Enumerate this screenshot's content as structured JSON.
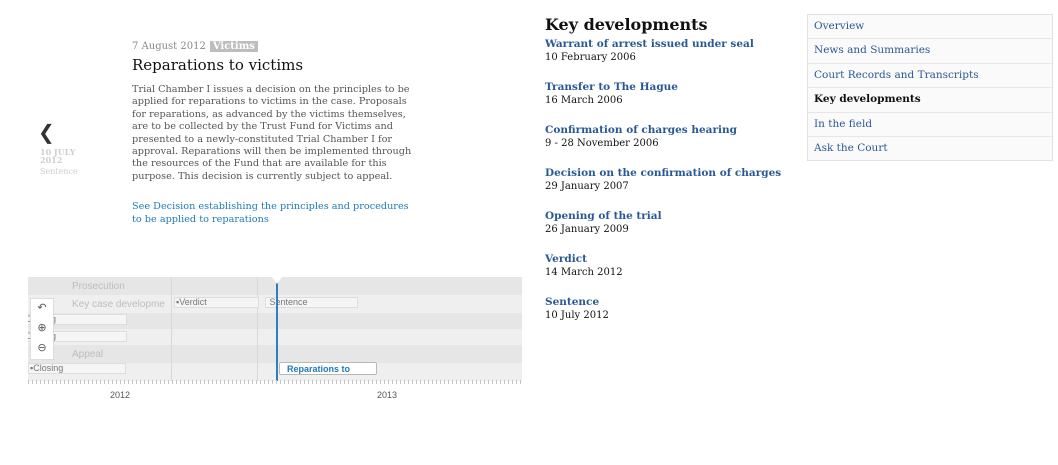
{
  "story": {
    "date": "7 August 2012",
    "tag": "Victims",
    "title": "Reparations to victims",
    "body": "Trial Chamber I issues a decision on the principles to be applied for reparations to victims in the case. Proposals for reparations, as advanced by the victims themselves, are to be collected by the Trust Fund for Victims and presented to a newly-constituted Trial Chamber I for approval. Reparations will then be implemented through the resources of the Fund that are available for this purpose. This decision is currently subject to appeal.",
    "link": "See Decision establishing the principles and procedures to be applied to reparations"
  },
  "previous": {
    "arrow": "❮",
    "date": "10 JULY 2012",
    "label": "Sentence"
  },
  "timeline": {
    "bands": [
      "Prosecution",
      "Key case developme",
      "",
      "",
      "Appeal"
    ],
    "events": {
      "verdict": "Verdict",
      "sentence": "Sentence",
      "closing1": "Closing",
      "closing2": "Closing",
      "closing3": "Closing"
    },
    "zoom": {
      "back": "↶",
      "zoom_in": "⊕",
      "zoom_out": "⊖"
    },
    "active_event": "Reparations to",
    "axis_years": [
      "2012",
      "2013"
    ]
  },
  "key_developments": {
    "heading": "Key developments",
    "items": [
      {
        "title": "Warrant of arrest issued under seal",
        "date": "10 February 2006"
      },
      {
        "title": "Transfer to The Hague",
        "date": "16 March 2006"
      },
      {
        "title": "Confirmation of charges hearing",
        "date": "9 - 28 November 2006"
      },
      {
        "title": "Decision on the confirmation of charges",
        "date": "29 January 2007"
      },
      {
        "title": "Opening of the trial",
        "date": "26 January 2009"
      },
      {
        "title": "Verdict",
        "date": "14 March 2012"
      },
      {
        "title": "Sentence",
        "date": "10 July 2012"
      }
    ]
  },
  "nav": {
    "items": [
      {
        "label": "Overview"
      },
      {
        "label": "News and Summaries"
      },
      {
        "label": "Court Records and Transcripts"
      },
      {
        "label": "Key developments"
      },
      {
        "label": "In the field"
      },
      {
        "label": "Ask the Court"
      }
    ]
  }
}
